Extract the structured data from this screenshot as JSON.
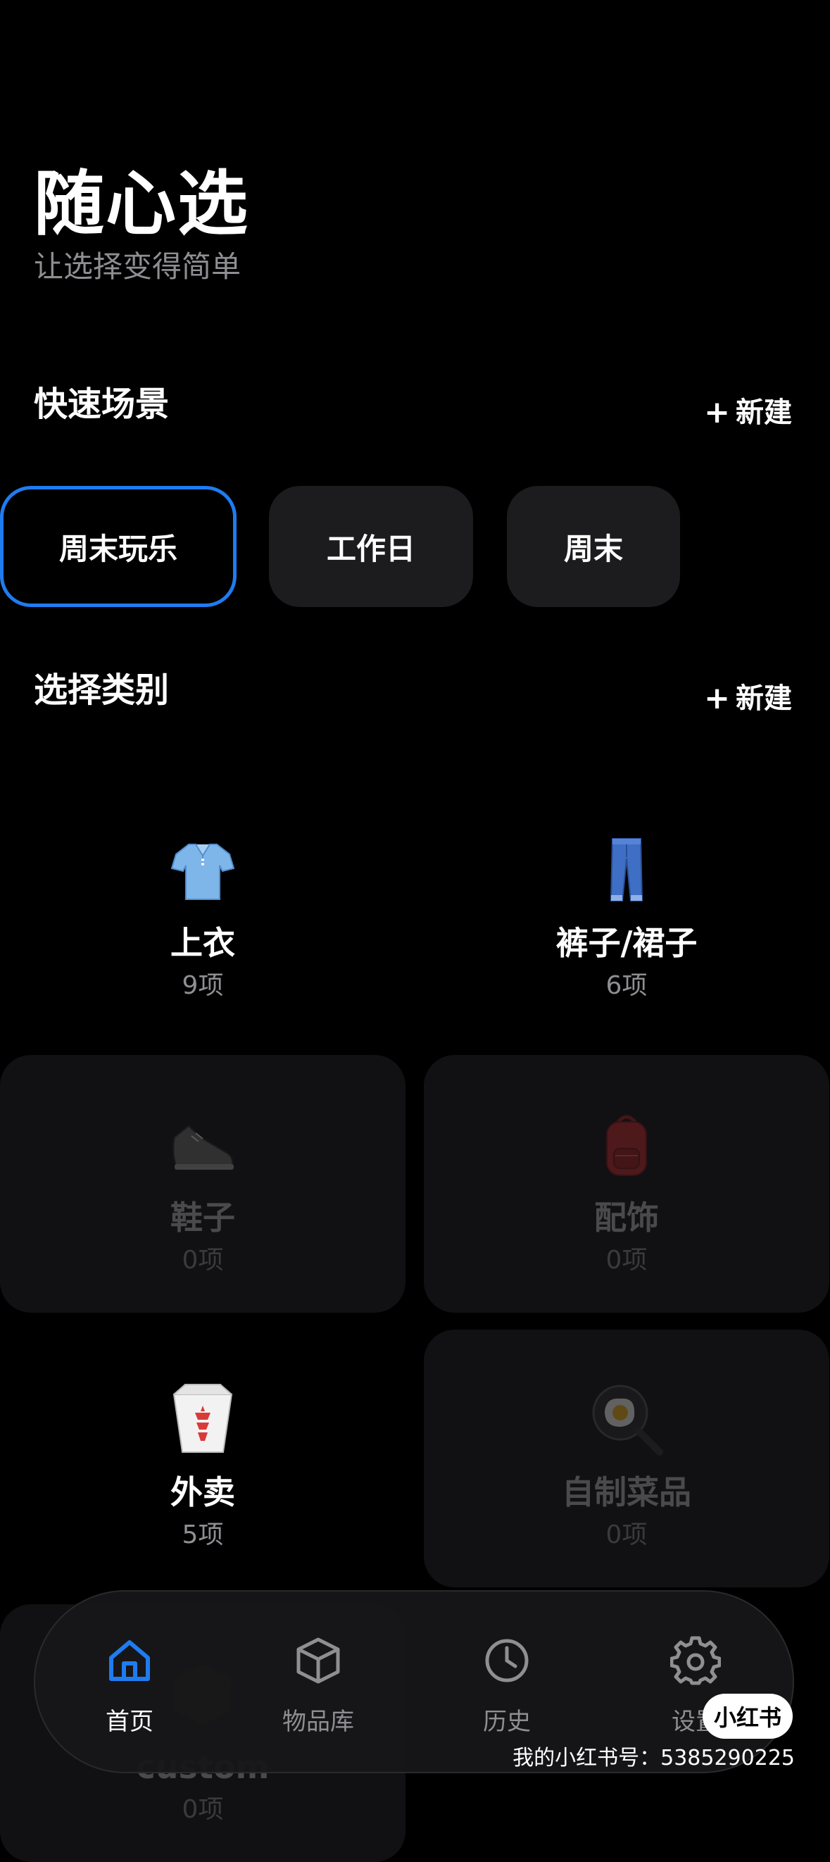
{
  "header": {
    "title": "随心选",
    "subtitle": "让选择变得简单"
  },
  "scenes": {
    "title": "快速场景",
    "new_label": "新建",
    "items": [
      {
        "label": "周末玩乐",
        "active": true
      },
      {
        "label": "工作日",
        "active": false
      },
      {
        "label": "周末",
        "active": false
      }
    ]
  },
  "categories": {
    "title": "选择类别",
    "new_label": "新建",
    "items": [
      {
        "name": "上衣",
        "count": "9项",
        "icon": "t-shirt-icon"
      },
      {
        "name": "裤子/裙子",
        "count": "6项",
        "icon": "jeans-icon"
      },
      {
        "name": "鞋子",
        "count": "0项",
        "icon": "sneaker-icon"
      },
      {
        "name": "配饰",
        "count": "0项",
        "icon": "backpack-icon"
      },
      {
        "name": "外卖",
        "count": "5项",
        "icon": "takeout-box-icon"
      },
      {
        "name": "自制菜品",
        "count": "0项",
        "icon": "frying-pan-icon"
      },
      {
        "name": "custom",
        "count": "0项",
        "icon": "package-icon"
      }
    ]
  },
  "tabbar": {
    "items": [
      {
        "label": "首页",
        "icon": "home-icon",
        "active": true
      },
      {
        "label": "物品库",
        "icon": "box-icon",
        "active": false
      },
      {
        "label": "历史",
        "icon": "clock-icon",
        "active": false
      },
      {
        "label": "设置",
        "icon": "gear-icon",
        "active": false
      }
    ]
  },
  "watermark": {
    "badge": "小红书",
    "account": "我的小红书号：5385290225"
  },
  "colors": {
    "background": "#000000",
    "accent": "#1f7cf0",
    "chip": "#1c1c1e",
    "muted": "#8e8e93"
  }
}
